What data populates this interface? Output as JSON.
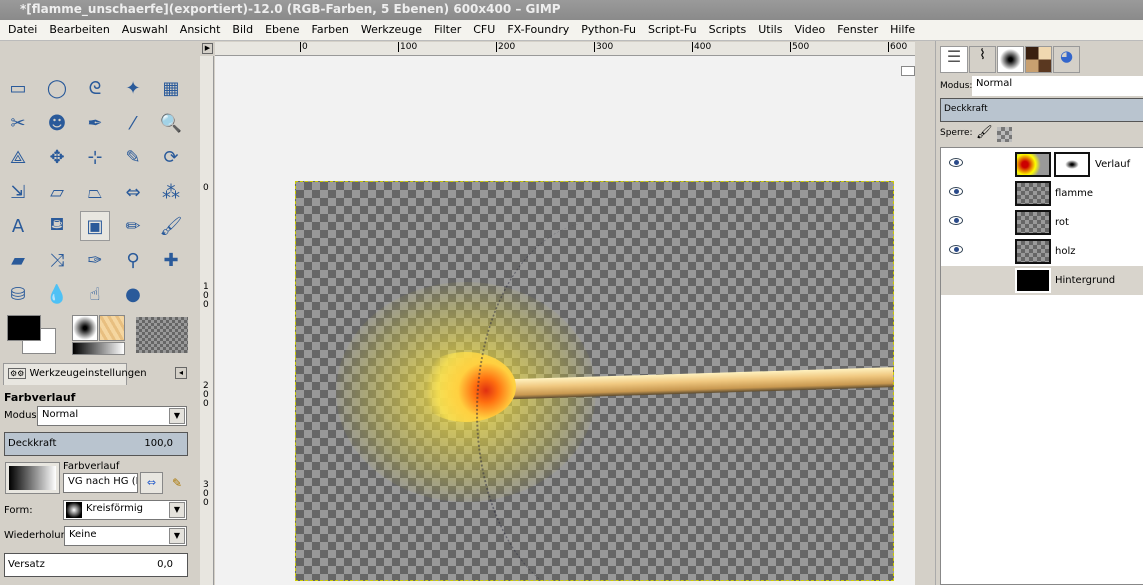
{
  "window": {
    "title": "*[flamme_unschaerfe](exportiert)-12.0 (RGB-Farben, 5 Ebenen) 600x400 – GIMP"
  },
  "menu": [
    "Datei",
    "Bearbeiten",
    "Auswahl",
    "Ansicht",
    "Bild",
    "Ebene",
    "Farben",
    "Werkzeuge",
    "Filter",
    "CFU",
    "FX-Foundry",
    "Python-Fu",
    "Script-Fu",
    "Scripts",
    "Utils",
    "Video",
    "Fenster",
    "Hilfe"
  ],
  "rulers": {
    "h": [
      "0",
      "100",
      "200",
      "300",
      "400",
      "500",
      "600"
    ],
    "v": [
      "0",
      "100",
      "200",
      "300"
    ]
  },
  "tools": [
    {
      "name": "rect-select",
      "g": "▭"
    },
    {
      "name": "ellipse-select",
      "g": "◯"
    },
    {
      "name": "free-select",
      "g": "ᘓ"
    },
    {
      "name": "fuzzy-select",
      "g": "✦"
    },
    {
      "name": "color-select",
      "g": "▦"
    },
    {
      "name": "scissors",
      "g": "✂"
    },
    {
      "name": "foreground-select",
      "g": "☻"
    },
    {
      "name": "paths",
      "g": "✒"
    },
    {
      "name": "color-picker",
      "g": "⁄"
    },
    {
      "name": "zoom",
      "g": "🔍"
    },
    {
      "name": "measure",
      "g": "⟁"
    },
    {
      "name": "move",
      "g": "✥"
    },
    {
      "name": "align",
      "g": "⊹"
    },
    {
      "name": "crop",
      "g": "✎"
    },
    {
      "name": "rotate",
      "g": "⟳"
    },
    {
      "name": "scale",
      "g": "⇲"
    },
    {
      "name": "shear",
      "g": "▱"
    },
    {
      "name": "perspective",
      "g": "⏢"
    },
    {
      "name": "flip",
      "g": "⇔"
    },
    {
      "name": "cage",
      "g": "⁂"
    },
    {
      "name": "text",
      "g": "A"
    },
    {
      "name": "bucket-fill",
      "g": "⛾"
    },
    {
      "name": "blend",
      "g": "▣"
    },
    {
      "name": "pencil",
      "g": "✏"
    },
    {
      "name": "paintbrush",
      "g": "🖌"
    },
    {
      "name": "eraser",
      "g": "▰"
    },
    {
      "name": "airbrush",
      "g": "⤨"
    },
    {
      "name": "ink",
      "g": "✑"
    },
    {
      "name": "clone",
      "g": "⚲"
    },
    {
      "name": "heal",
      "g": "✚"
    },
    {
      "name": "perspective-clone",
      "g": "⛁"
    },
    {
      "name": "blur",
      "g": "💧"
    },
    {
      "name": "smudge",
      "g": "☝"
    },
    {
      "name": "dodge-burn",
      "g": "●"
    }
  ],
  "tool_options": {
    "tab_label": "Werkzeugeinstellungen",
    "title": "Farbverlauf",
    "mode_label": "Modus:",
    "mode_value": "Normal",
    "opacity_label": "Deckkraft",
    "opacity_value": "100,0",
    "gradient_label": "Farbverlauf",
    "gradient_value": "VG nach HG (RGB)",
    "shape_label": "Form:",
    "shape_value": "Kreisförmig",
    "repeat_label": "Wiederholung:",
    "repeat_value": "Keine",
    "offset_label": "Versatz",
    "offset_value": "0,0"
  },
  "layers_panel": {
    "mode_label": "Modus:",
    "mode_value": "Normal",
    "opacity_label": "Deckkraft",
    "lock_label": "Sperre:",
    "layers": [
      {
        "name": "Verlauf",
        "visible": true
      },
      {
        "name": "flamme",
        "visible": true
      },
      {
        "name": "rot",
        "visible": true
      },
      {
        "name": "holz",
        "visible": true
      },
      {
        "name": "Hintergrund",
        "visible": false
      }
    ]
  }
}
